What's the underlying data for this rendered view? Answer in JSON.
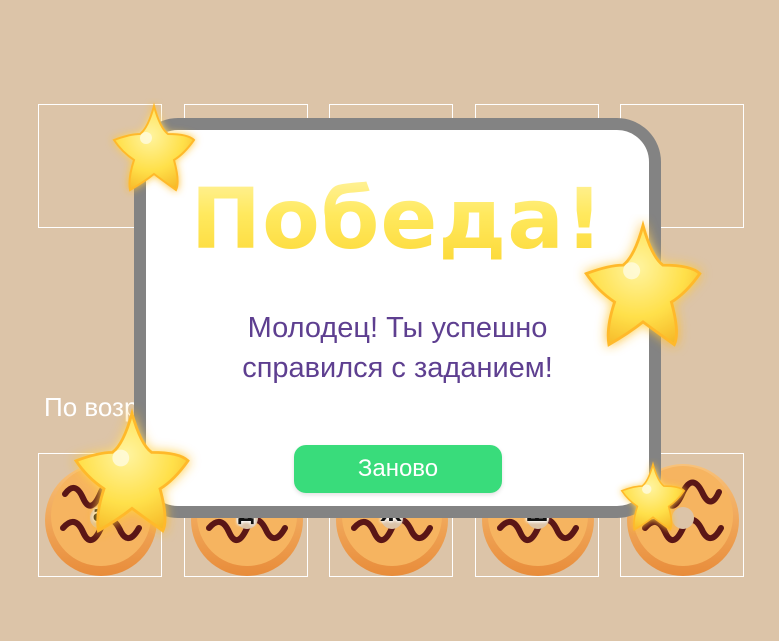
{
  "game": {
    "instruction": "По возрастанию"
  },
  "answer_slots": [
    "",
    "",
    "",
    "",
    ""
  ],
  "donuts": [
    {
      "letter": "а"
    },
    {
      "letter": "д"
    },
    {
      "letter": "ж"
    },
    {
      "letter": "ш"
    },
    {
      "letter": ""
    }
  ],
  "modal": {
    "title": "Победа!",
    "message_line1": "Молодец! Ты успешно",
    "message_line2": "справился с заданием!",
    "restart_label": "Заново"
  },
  "colors": {
    "background": "#dcc4a8",
    "modal_border": "#838383",
    "title_gold": "#ffe95e",
    "message_purple": "#5e3f90",
    "button_green": "#39dc7b",
    "star_yellow": "#ffe04a",
    "star_glow": "#7b4cf0"
  },
  "icons": {
    "donut": "donut-icon",
    "star": "star-icon"
  }
}
